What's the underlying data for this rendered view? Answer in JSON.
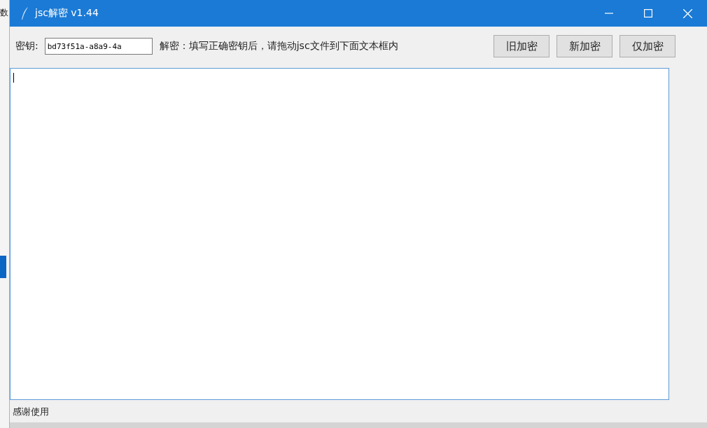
{
  "background": {
    "text": "数"
  },
  "window": {
    "title": "jsc解密 v1.44"
  },
  "key_field": {
    "label": "密钥:",
    "value": "bd73f51a-a8a9-4a"
  },
  "hint": "解密：填写正确密钥后，请拖动jsc文件到下面文本框内",
  "buttons": [
    {
      "label": "旧加密"
    },
    {
      "label": "新加密"
    },
    {
      "label": "仅加密"
    }
  ],
  "text_area": {
    "focused": true
  },
  "status_bar": {
    "text": "感谢使用"
  }
}
